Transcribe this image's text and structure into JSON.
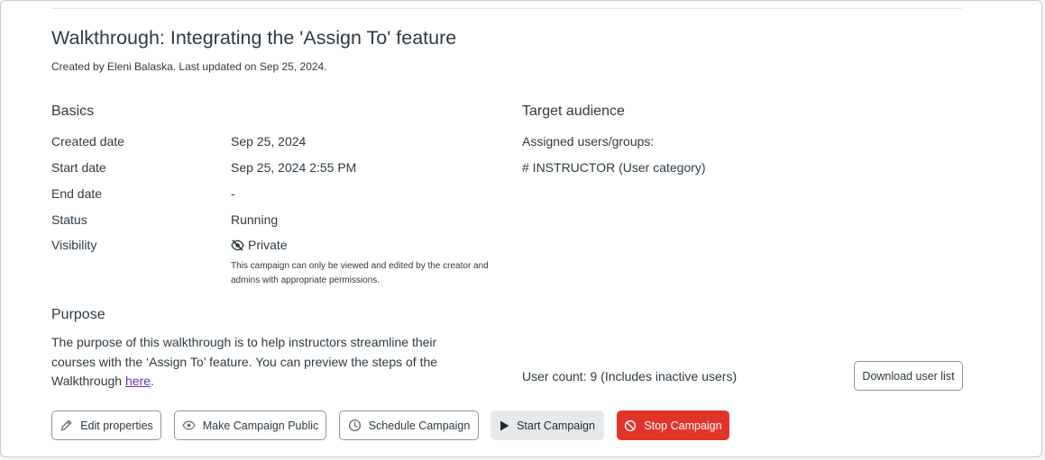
{
  "campaign": {
    "title": "Walkthrough: Integrating the 'Assign To' feature",
    "subtitle": "Created by Eleni Balaska. Last updated on Sep 25, 2024."
  },
  "basics": {
    "heading": "Basics",
    "rows": [
      {
        "label": "Created date",
        "value": "Sep 25, 2024"
      },
      {
        "label": "Start date",
        "value": "Sep 25, 2024 2:55 PM"
      },
      {
        "label": "End date",
        "value": "-"
      },
      {
        "label": "Status",
        "value": "Running"
      },
      {
        "label": "Visibility",
        "value": "Private"
      }
    ],
    "visibility_icon": "eye-slash-icon",
    "visibility_note": "This campaign can only be viewed and edited by the creator and admins with appropriate permissions."
  },
  "purpose": {
    "heading": "Purpose",
    "text_before_link": "The purpose of this walkthrough is to help instructors streamline their courses with the ‘Assign To’ feature. You can preview the steps of the Walkthrough ",
    "link_text": "here",
    "text_after_link": "."
  },
  "audience": {
    "heading": "Target audience",
    "assigned_label": "Assigned users/groups:",
    "assigned_item": "# INSTRUCTOR (User category)",
    "user_count": "User count: 9 (Includes inactive users)",
    "download_label": "Download user list"
  },
  "actions": {
    "edit_label": "Edit properties",
    "public_label": "Make Campaign Public",
    "schedule_label": "Schedule Campaign",
    "start_label": "Start Campaign",
    "stop_label": "Stop Campaign",
    "edit_icon": "pencil-icon",
    "public_icon": "eye-icon",
    "schedule_icon": "clock-icon",
    "start_icon": "play-icon",
    "stop_icon": "no-entry-icon"
  },
  "colors": {
    "danger": "#e0342b",
    "link": "#6b2fb3",
    "text": "#2d3b45"
  }
}
